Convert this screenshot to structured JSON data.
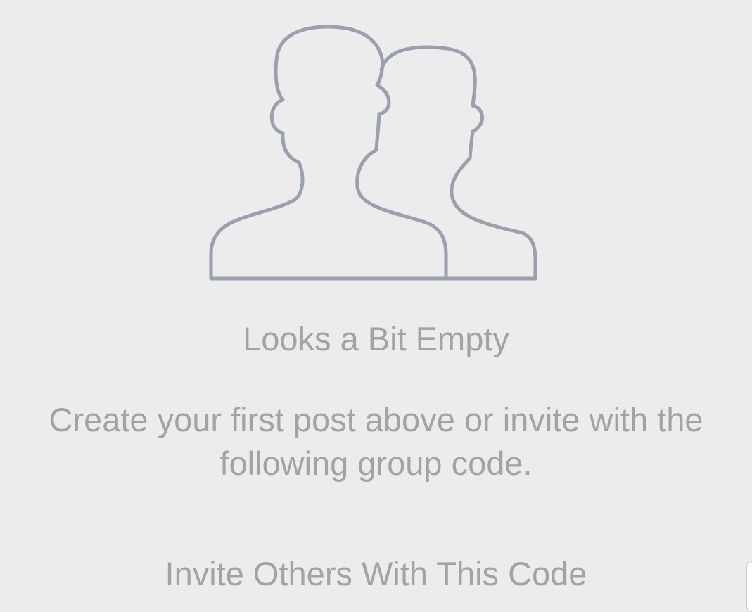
{
  "empty_state": {
    "illustration_icon": "group-people-icon",
    "title": "Looks a Bit Empty",
    "message": "Create your first post above or invite with the following group code.",
    "invite_heading": "Invite Others With This Code"
  },
  "colors": {
    "background": "#ececec",
    "text": "#a3a3a3",
    "icon_stroke": "#9aa1ae"
  }
}
